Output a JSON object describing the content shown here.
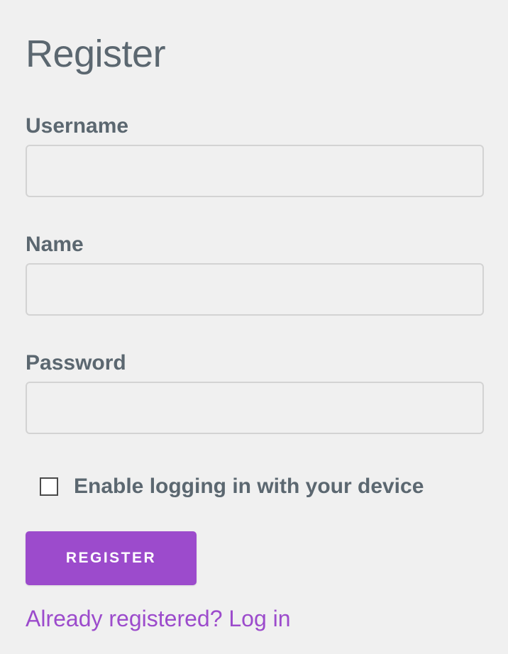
{
  "page": {
    "title": "Register"
  },
  "form": {
    "username": {
      "label": "Username",
      "value": "",
      "placeholder": ""
    },
    "name": {
      "label": "Name",
      "value": "",
      "placeholder": ""
    },
    "password": {
      "label": "Password",
      "value": "",
      "placeholder": ""
    },
    "device_login": {
      "label": "Enable logging in with your device",
      "checked": false
    },
    "submit_label": "REGISTER"
  },
  "footer": {
    "login_link_text": "Already registered? Log in"
  },
  "colors": {
    "background": "#f0f0f0",
    "text": "#5b6770",
    "accent": "#9c4bcc",
    "input_border": "#d3d3d3"
  }
}
